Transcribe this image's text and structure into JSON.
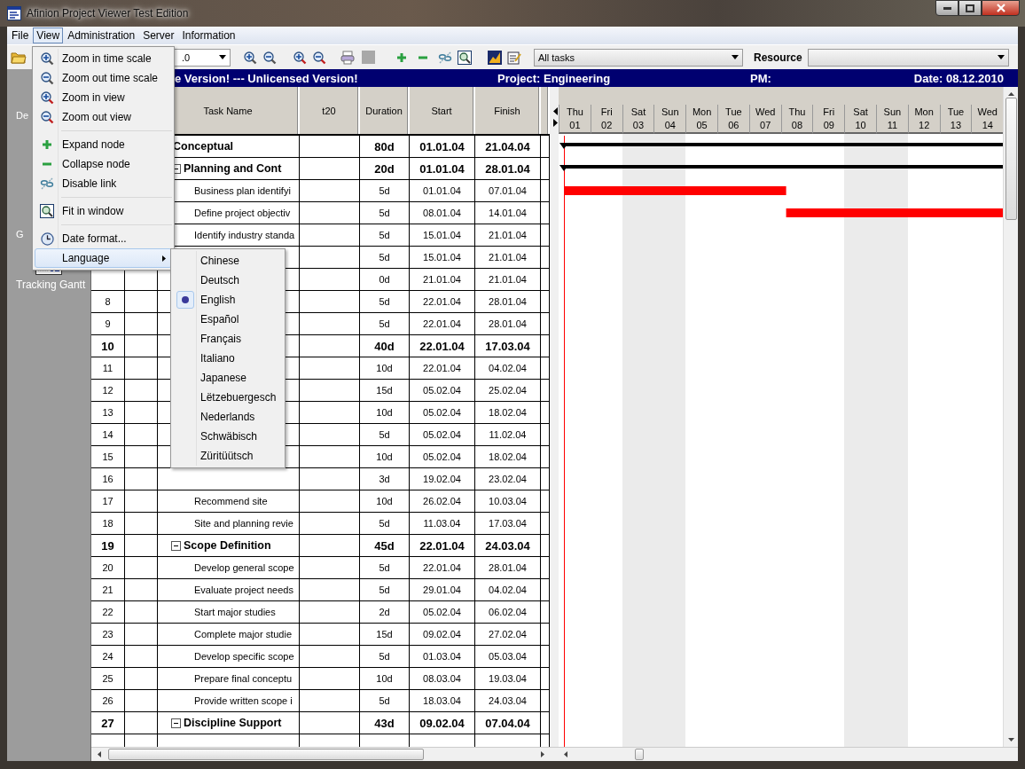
{
  "window": {
    "title": "Afinion Project Viewer Test Edition"
  },
  "menu_bar": [
    {
      "label": "File",
      "selected": false
    },
    {
      "label": "View",
      "selected": true
    },
    {
      "label": "Administration",
      "selected": false
    },
    {
      "label": "Server",
      "selected": false
    },
    {
      "label": "Information",
      "selected": false
    }
  ],
  "toolbar": {
    "zoom_combo": {
      "value": ".0"
    },
    "filter_combo": {
      "value": "All tasks"
    },
    "resource_label": "Resource"
  },
  "sidebar": {
    "items": [
      {
        "label": "De"
      },
      {
        "label": "G"
      },
      {
        "label": "Tracking Gantt"
      }
    ]
  },
  "banner": {
    "notice": "e Version! --- Unlicensed Version!",
    "project": "Project: Engineering",
    "pm": "PM:",
    "date": "Date: 08.12.2010"
  },
  "table": {
    "columns": [
      "Task Name",
      "t20",
      "Duration",
      "Start",
      "Finish"
    ],
    "rows": [
      {
        "name": "Conceptual",
        "duration": "80d",
        "start": "01.01.04",
        "finish": "21.04.04",
        "children": [
          {
            "name": "Planning and Cont",
            "duration": "20d",
            "start": "01.01.04",
            "finish": "28.01.04",
            "expanded": true,
            "children": [
              {
                "name": "Business plan identifyi",
                "duration": "5d",
                "start": "01.01.04",
                "finish": "07.01.04"
              },
              {
                "name": "Define project objectiv",
                "duration": "5d",
                "start": "08.01.04",
                "finish": "14.01.04"
              },
              {
                "name": "Identify industry standa",
                "duration": "5d",
                "start": "15.01.04",
                "finish": "21.01.04"
              },
              {
                "duration": "5d",
                "start": "15.01.04",
                "finish": "21.01.04"
              },
              {
                "duration": "0d",
                "start": "21.01.04",
                "finish": "21.01.04"
              },
              {
                "number": "8",
                "duration": "5d",
                "start": "22.01.04",
                "finish": "28.01.04"
              },
              {
                "number": "9",
                "duration": "5d",
                "start": "22.01.04",
                "finish": "28.01.04"
              }
            ]
          },
          {
            "number": "10",
            "duration": "40d",
            "start": "22.01.04",
            "finish": "17.03.04",
            "children": [
              {
                "number": "11",
                "duration": "10d",
                "start": "22.01.04",
                "finish": "04.02.04"
              },
              {
                "number": "12",
                "duration": "15d",
                "start": "05.02.04",
                "finish": "25.02.04"
              },
              {
                "number": "13",
                "duration": "10d",
                "start": "05.02.04",
                "finish": "18.02.04"
              },
              {
                "number": "14",
                "duration": "5d",
                "start": "05.02.04",
                "finish": "11.02.04"
              },
              {
                "number": "15",
                "duration": "10d",
                "start": "05.02.04",
                "finish": "18.02.04"
              },
              {
                "number": "16",
                "duration": "3d",
                "start": "19.02.04",
                "finish": "23.02.04"
              },
              {
                "number": "17",
                "name": "Recommend site",
                "duration": "10d",
                "start": "26.02.04",
                "finish": "10.03.04"
              },
              {
                "number": "18",
                "name": "Site and planning revie",
                "duration": "5d",
                "start": "11.03.04",
                "finish": "17.03.04"
              }
            ]
          },
          {
            "number": "19",
            "name": "Scope Definition",
            "duration": "45d",
            "start": "22.01.04",
            "finish": "24.03.04",
            "expanded": true,
            "children": [
              {
                "number": "20",
                "name": "Develop general scope",
                "duration": "5d",
                "start": "22.01.04",
                "finish": "28.01.04"
              },
              {
                "number": "21",
                "name": "Evaluate project needs",
                "duration": "5d",
                "start": "29.01.04",
                "finish": "04.02.04"
              },
              {
                "number": "22",
                "name": "Start major studies",
                "duration": "2d",
                "start": "05.02.04",
                "finish": "06.02.04"
              },
              {
                "number": "23",
                "name": "Complete major studie",
                "duration": "15d",
                "start": "09.02.04",
                "finish": "27.02.04"
              },
              {
                "number": "24",
                "name": "Develop specific scope",
                "duration": "5d",
                "start": "01.03.04",
                "finish": "05.03.04"
              },
              {
                "number": "25",
                "name": "Prepare final conceptu",
                "duration": "10d",
                "start": "08.03.04",
                "finish": "19.03.04"
              },
              {
                "number": "26",
                "name": "Provide written scope i",
                "duration": "5d",
                "start": "18.03.04",
                "finish": "24.03.04"
              }
            ]
          },
          {
            "number": "27",
            "name": "Discipline Support",
            "duration": "43d",
            "start": "09.02.04",
            "finish": "07.04.04",
            "expanded": true
          }
        ]
      }
    ]
  },
  "gantt": {
    "days": [
      {
        "weekday": "Thu",
        "date": "01",
        "weekend": false
      },
      {
        "weekday": "Fri",
        "date": "02",
        "weekend": false
      },
      {
        "weekday": "Sat",
        "date": "03",
        "weekend": true
      },
      {
        "weekday": "Sun",
        "date": "04",
        "weekend": true
      },
      {
        "weekday": "Mon",
        "date": "05",
        "weekend": false
      },
      {
        "weekday": "Tue",
        "date": "06",
        "weekend": false
      },
      {
        "weekday": "Wed",
        "date": "07",
        "weekend": false
      },
      {
        "weekday": "Thu",
        "date": "08",
        "weekend": false
      },
      {
        "weekday": "Fri",
        "date": "09",
        "weekend": false
      },
      {
        "weekday": "Sat",
        "date": "10",
        "weekend": true
      },
      {
        "weekday": "Sun",
        "date": "11",
        "weekend": true
      },
      {
        "weekday": "Mon",
        "date": "12",
        "weekend": false
      },
      {
        "weekday": "Tue",
        "date": "13",
        "weekend": false
      },
      {
        "weekday": "Wed",
        "date": "14",
        "weekend": false
      }
    ]
  },
  "view_menu": {
    "items": [
      {
        "kind": "item",
        "label": "Zoom in time scale",
        "selected": false
      },
      {
        "kind": "item",
        "label": "Zoom out time scale",
        "selected": false
      },
      {
        "kind": "item",
        "label": "Zoom in view",
        "selected": false
      },
      {
        "kind": "item",
        "label": "Zoom out view",
        "selected": false
      },
      {
        "kind": "separator"
      },
      {
        "kind": "item",
        "label": "Expand node",
        "selected": false
      },
      {
        "kind": "item",
        "label": "Collapse node",
        "selected": false
      },
      {
        "kind": "item",
        "label": "Disable link",
        "selected": false
      },
      {
        "kind": "separator"
      },
      {
        "kind": "item",
        "label": "Fit in window",
        "selected": false
      },
      {
        "kind": "separator"
      },
      {
        "kind": "item",
        "label": "Date format...",
        "selected": false
      },
      {
        "kind": "submenu",
        "label": "Language",
        "selected": true
      }
    ]
  },
  "language_menu": {
    "items": [
      {
        "label": "Chinese",
        "selected": false
      },
      {
        "label": "Deutsch",
        "selected": false
      },
      {
        "label": "English",
        "selected": true
      },
      {
        "label": "Español",
        "selected": false
      },
      {
        "label": "Français",
        "selected": false
      },
      {
        "label": "Italiano",
        "selected": false
      },
      {
        "label": "Japanese",
        "selected": false
      },
      {
        "label": "Lëtzebuergesch",
        "selected": false
      },
      {
        "label": "Nederlands",
        "selected": false
      },
      {
        "label": "Schwäbisch",
        "selected": false
      },
      {
        "label": "Züritüütsch",
        "selected": false
      }
    ]
  }
}
